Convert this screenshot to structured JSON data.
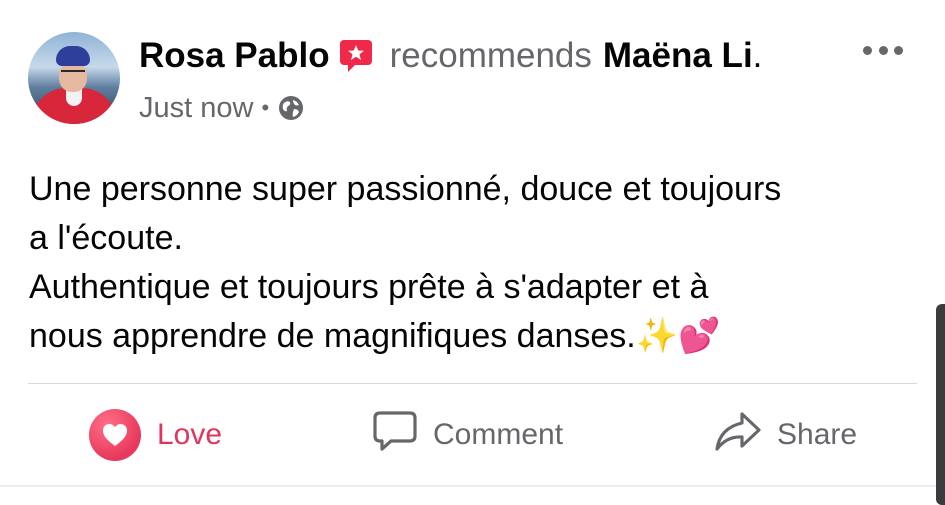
{
  "post": {
    "author": "Rosa Pablo",
    "verb": "recommends",
    "target": "Maëna Li",
    "target_suffix": ".",
    "timestamp": "Just now",
    "separator": "•",
    "audience_icon": "globe-icon",
    "recommend_badge_icon": "star-speech-bubble-icon",
    "body": "Une personne super passionné, douce et toujours\na l'écoute.\nAuthentique et toujours prête à s'adapter et à\nnous apprendre de magnifiques danses.✨💕"
  },
  "actions": {
    "love_label": "Love",
    "comment_label": "Comment",
    "share_label": "Share"
  },
  "colors": {
    "love": "#E0365D",
    "secondary_text": "#65676B",
    "badge": "#F0284A",
    "divider": "#D7D9DD"
  }
}
